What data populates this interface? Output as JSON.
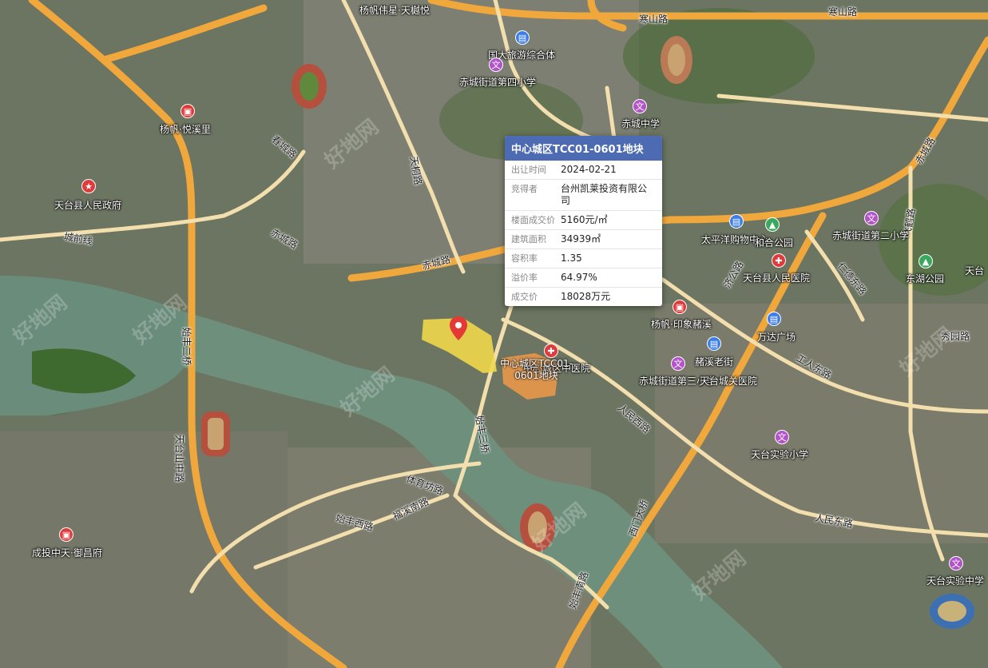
{
  "popup": {
    "title": "中心城区TCC01-0601地块",
    "rows": [
      {
        "key": "出让时间",
        "value": "2024-02-21"
      },
      {
        "key": "竞得者",
        "value": "台州凯莱投资有限公司"
      },
      {
        "key": "楼面成交价",
        "value": "5160元/㎡"
      },
      {
        "key": "建筑面积",
        "value": "34939㎡"
      },
      {
        "key": "容积率",
        "value": "1.35"
      },
      {
        "key": "溢价率",
        "value": "64.97%"
      },
      {
        "key": "成交价",
        "value": "18028万元"
      }
    ]
  },
  "parcel": {
    "label_line1": "中心城区TCC01-",
    "label_line2": "0601地块",
    "fill_color": "#f0d84a",
    "adjacent_fill_color": "#f09a4a"
  },
  "roads": {
    "hanshan1": "寒山路",
    "hanshan2": "寒山路",
    "chicheng": "赤城路",
    "chicheng2": "赤城路",
    "chengqian": "城前线",
    "chenglian": "春城路",
    "tiantong": "天桐路",
    "shifeng": "始丰二桥",
    "shifeng3": "始丰三桥",
    "tiantaishan": "天台山中路",
    "renminxi": "人民西路",
    "renmindong": "人民东路",
    "xiuyuan": "秀园路",
    "gongren": "工人东路",
    "tiyufang": "体育坊路",
    "shifengxi": "始丰西路",
    "fuxi": "福溪南路",
    "shifengnan": "始丰南路",
    "xiqu": "西门大桥",
    "feihe": "飞鹤路",
    "jiaotong": "济公路",
    "renmin2": "仁德东路",
    "chiyuan": "赤城路"
  },
  "places": {
    "gov": "天台县人民政府",
    "yueyuanli": "杨帆·悦溪里",
    "tianluyue": "杨帆伟星·天樾悦",
    "guoda": "国大旅游综合体",
    "chicheng4": "赤城街道第四小学",
    "chichengzx": "赤城中学",
    "taipingyang": "太平洋购物中心",
    "hehuan": "和合公园",
    "chicheng2xx": "赤城街道第二小学",
    "dongshu": "东湖公园",
    "tiantaihos": "天台县人民医院",
    "yinxiang": "杨帆·印象赭溪",
    "wanyu": "万达广场",
    "zhexi": "赭溪老街",
    "chicheng3": "赤城街道第三小学",
    "tiantaicheng": "天台城关医院",
    "zhongyi": "中心城区中医院",
    "shiyan": "天台实验小学",
    "shiyanzx": "天台实验中学",
    "chengtou": "成投中天·御昌府",
    "tiantai": "天台"
  },
  "watermark": "好地网"
}
